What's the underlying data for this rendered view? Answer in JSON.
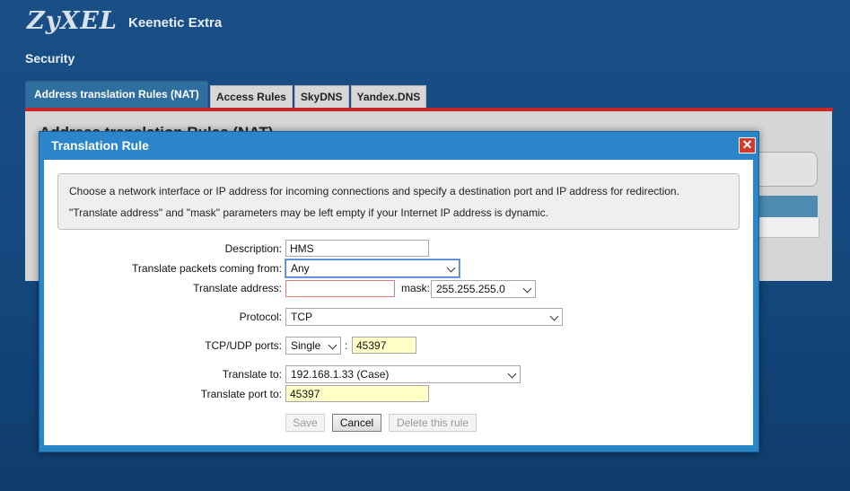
{
  "app": {
    "brand": "ZyXEL",
    "product": "Keenetic Extra",
    "section": "Security"
  },
  "tabs": [
    {
      "label": "Address translation Rules (NAT)",
      "active": true
    },
    {
      "label": "Access Rules"
    },
    {
      "label": "SkyDNS"
    },
    {
      "label": "Yandex.DNS"
    }
  ],
  "background_page": {
    "title": "Address translation Rules (NAT)"
  },
  "dialog": {
    "title": "Translation Rule",
    "info_line1": "Choose a network interface or IP address for incoming connections and specify a destination port and IP address for redirection.",
    "info_line2": "\"Translate address\" and \"mask\" parameters may be left empty if your Internet IP address is dynamic.",
    "fields": {
      "description": {
        "label": "Description:",
        "value": "HMS"
      },
      "from": {
        "label": "Translate packets coming from:",
        "value": "Any"
      },
      "address": {
        "label": "Translate address:",
        "value": ""
      },
      "mask": {
        "label": "mask:",
        "value": "255.255.255.0"
      },
      "protocol": {
        "label": "Protocol:",
        "value": "TCP"
      },
      "ports": {
        "label": "TCP/UDP ports:",
        "mode": "Single",
        "separator": ":",
        "value": "45397"
      },
      "translate_to": {
        "label": "Translate to:",
        "value": "192.168.1.33 (Case)"
      },
      "translate_port": {
        "label": "Translate port to:",
        "value": "45397"
      }
    },
    "buttons": {
      "save": "Save",
      "cancel": "Cancel",
      "delete": "Delete this rule"
    }
  },
  "colors": {
    "accent": "#2a86c9",
    "tab_active": "#2f6f9f",
    "tab_line": "#c9262a",
    "field_highlight": "#ffffc6"
  }
}
